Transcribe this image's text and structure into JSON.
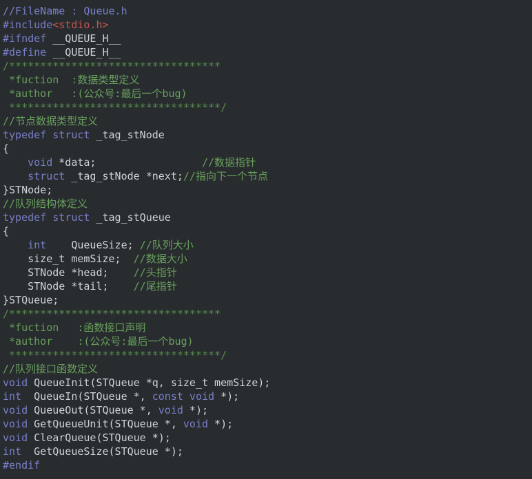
{
  "editor": {
    "title": "Queue.h",
    "language": "C header",
    "background_color": "#282c2f",
    "colors": {
      "keyword": "#7a7fc9",
      "preprocessor": "#7a7fc9",
      "plain": "#cfd2d6",
      "comment": "#588c4e",
      "comment_bright": "#69a05c",
      "string": "#c75450"
    },
    "line_count": 31
  },
  "code_lines": [
    {
      "n": 1,
      "tokens": [
        {
          "t": "//FileName : Queue.h",
          "c": "tok-purple"
        }
      ]
    },
    {
      "n": 2,
      "tokens": [
        {
          "t": "#include",
          "c": "tok-pre"
        },
        {
          "t": "<stdio.h>",
          "c": "tok-str"
        }
      ]
    },
    {
      "n": 3,
      "tokens": [
        {
          "t": "#ifndef",
          "c": "tok-pre"
        },
        {
          "t": " __QUEUE_H__",
          "c": "tok-plain"
        }
      ]
    },
    {
      "n": 4,
      "tokens": [
        {
          "t": "#define",
          "c": "tok-pre"
        },
        {
          "t": " __QUEUE_H__",
          "c": "tok-plain"
        }
      ]
    },
    {
      "n": 5,
      "tokens": [
        {
          "t": "/**********************************",
          "c": "tok-cmt"
        }
      ]
    },
    {
      "n": 6,
      "tokens": [
        {
          "t": " *fuction  :数据类型定义",
          "c": "tok-cmt2"
        }
      ]
    },
    {
      "n": 7,
      "tokens": [
        {
          "t": " *author   :(公众号:最后一个bug)",
          "c": "tok-cmt2"
        }
      ]
    },
    {
      "n": 8,
      "tokens": [
        {
          "t": " **********************************/",
          "c": "tok-cmt"
        }
      ]
    },
    {
      "n": 9,
      "tokens": [
        {
          "t": "//节点数据类型定义",
          "c": "tok-cmt2"
        }
      ]
    },
    {
      "n": 10,
      "tokens": [
        {
          "t": "typedef struct",
          "c": "tok-kw"
        },
        {
          "t": " _tag_stNode",
          "c": "tok-plain"
        }
      ]
    },
    {
      "n": 11,
      "tokens": [
        {
          "t": "{",
          "c": "tok-plain"
        }
      ]
    },
    {
      "n": 12,
      "tokens": [
        {
          "t": "    ",
          "c": "tok-plain"
        },
        {
          "t": "void",
          "c": "tok-kw"
        },
        {
          "t": " *data;                 ",
          "c": "tok-plain"
        },
        {
          "t": "//数据指针",
          "c": "tok-cmt2"
        }
      ]
    },
    {
      "n": 13,
      "tokens": [
        {
          "t": "    ",
          "c": "tok-plain"
        },
        {
          "t": "struct",
          "c": "tok-kw"
        },
        {
          "t": " _tag_stNode *next;",
          "c": "tok-plain"
        },
        {
          "t": "//指向下一个节点",
          "c": "tok-cmt2"
        }
      ]
    },
    {
      "n": 14,
      "tokens": [
        {
          "t": "}STNode;",
          "c": "tok-plain"
        }
      ]
    },
    {
      "n": 15,
      "tokens": [
        {
          "t": "//队列结构体定义",
          "c": "tok-cmt2"
        }
      ]
    },
    {
      "n": 16,
      "tokens": [
        {
          "t": "typedef struct",
          "c": "tok-kw"
        },
        {
          "t": " _tag_stQueue",
          "c": "tok-plain"
        }
      ]
    },
    {
      "n": 17,
      "tokens": [
        {
          "t": "{",
          "c": "tok-plain"
        }
      ]
    },
    {
      "n": 18,
      "tokens": [
        {
          "t": "    ",
          "c": "tok-plain"
        },
        {
          "t": "int",
          "c": "tok-kw"
        },
        {
          "t": "    QueueSize; ",
          "c": "tok-plain"
        },
        {
          "t": "//队列大小",
          "c": "tok-cmt2"
        }
      ]
    },
    {
      "n": 19,
      "tokens": [
        {
          "t": "    size_t memSize;  ",
          "c": "tok-plain"
        },
        {
          "t": "//数据大小",
          "c": "tok-cmt2"
        }
      ]
    },
    {
      "n": 20,
      "tokens": [
        {
          "t": "    STNode *head;    ",
          "c": "tok-plain"
        },
        {
          "t": "//头指针",
          "c": "tok-cmt2"
        }
      ]
    },
    {
      "n": 21,
      "tokens": [
        {
          "t": "    STNode *tail;    ",
          "c": "tok-plain"
        },
        {
          "t": "//尾指针",
          "c": "tok-cmt2"
        }
      ]
    },
    {
      "n": 22,
      "tokens": [
        {
          "t": "}STQueue;",
          "c": "tok-plain"
        }
      ]
    },
    {
      "n": 23,
      "tokens": [
        {
          "t": "/**********************************",
          "c": "tok-cmt"
        }
      ]
    },
    {
      "n": 24,
      "tokens": [
        {
          "t": " *fuction   :函数接口声明",
          "c": "tok-cmt2"
        }
      ]
    },
    {
      "n": 25,
      "tokens": [
        {
          "t": " *author    :(公众号:最后一个bug)",
          "c": "tok-cmt2"
        }
      ]
    },
    {
      "n": 26,
      "tokens": [
        {
          "t": " **********************************/",
          "c": "tok-cmt"
        }
      ]
    },
    {
      "n": 27,
      "tokens": [
        {
          "t": "//队列接口函数定义",
          "c": "tok-cmt2"
        }
      ]
    },
    {
      "n": 28,
      "tokens": [
        {
          "t": "void",
          "c": "tok-kw"
        },
        {
          "t": " QueueInit(STQueue *q, size_t memSize);",
          "c": "tok-plain"
        }
      ]
    },
    {
      "n": 29,
      "tokens": [
        {
          "t": "int",
          "c": "tok-kw"
        },
        {
          "t": "  QueueIn(STQueue *, ",
          "c": "tok-plain"
        },
        {
          "t": "const void",
          "c": "tok-kw"
        },
        {
          "t": " *);",
          "c": "tok-plain"
        }
      ]
    },
    {
      "n": 30,
      "tokens": [
        {
          "t": "void",
          "c": "tok-kw"
        },
        {
          "t": " QueueOut(STQueue *, ",
          "c": "tok-plain"
        },
        {
          "t": "void",
          "c": "tok-kw"
        },
        {
          "t": " *);",
          "c": "tok-plain"
        }
      ]
    },
    {
      "n": 31,
      "tokens": [
        {
          "t": "void",
          "c": "tok-kw"
        },
        {
          "t": " GetQueueUnit(STQueue *, ",
          "c": "tok-plain"
        },
        {
          "t": "void",
          "c": "tok-kw"
        },
        {
          "t": " *);",
          "c": "tok-plain"
        }
      ]
    },
    {
      "n": 32,
      "tokens": [
        {
          "t": "void",
          "c": "tok-kw"
        },
        {
          "t": " ClearQueue(STQueue *);",
          "c": "tok-plain"
        }
      ]
    },
    {
      "n": 33,
      "tokens": [
        {
          "t": "int",
          "c": "tok-kw"
        },
        {
          "t": "  GetQueueSize(STQueue *);",
          "c": "tok-plain"
        }
      ]
    },
    {
      "n": 34,
      "tokens": [
        {
          "t": "#endif",
          "c": "tok-pre"
        }
      ]
    }
  ]
}
